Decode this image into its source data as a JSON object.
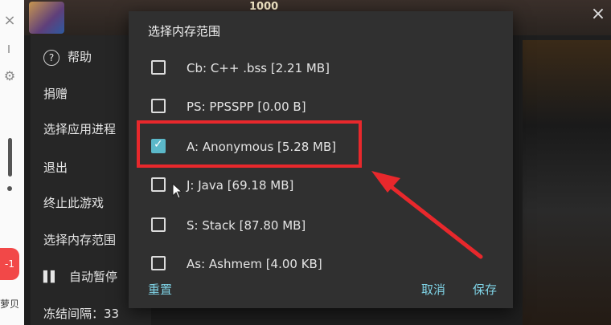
{
  "overlay_toolbar": {
    "close_glyph": "×",
    "badge": "-1",
    "name": "萝贝"
  },
  "game": {
    "counter": "1000",
    "close_glyph": "×"
  },
  "side_menu": {
    "items": [
      {
        "label": "帮助"
      },
      {
        "label": "捐赠"
      },
      {
        "label": "选择应用进程"
      },
      {
        "label": "退出"
      },
      {
        "label": "终止此游戏"
      },
      {
        "label": "选择内存范围"
      },
      {
        "label": "自动暂停"
      },
      {
        "label": "冻结间隔：33"
      }
    ]
  },
  "dialog": {
    "title": "选择内存范围",
    "options": [
      {
        "label": "Cb: C++ .bss [2.21 MB]",
        "checked": false
      },
      {
        "label": "PS: PPSSPP [0.00 B]",
        "checked": false
      },
      {
        "label": "A: Anonymous [5.28 MB]",
        "checked": true
      },
      {
        "label": "J: Java [69.18 MB]",
        "checked": false
      },
      {
        "label": "S: Stack [87.80 MB]",
        "checked": false
      },
      {
        "label": "As: Ashmem [4.00 KB]",
        "checked": false
      }
    ],
    "reset_label": "重置",
    "cancel_label": "取消",
    "save_label": "保存"
  },
  "colors": {
    "accent": "#7fd3e6",
    "checkbox_checked": "#5bb8c9",
    "annotation": "#e8282c"
  }
}
